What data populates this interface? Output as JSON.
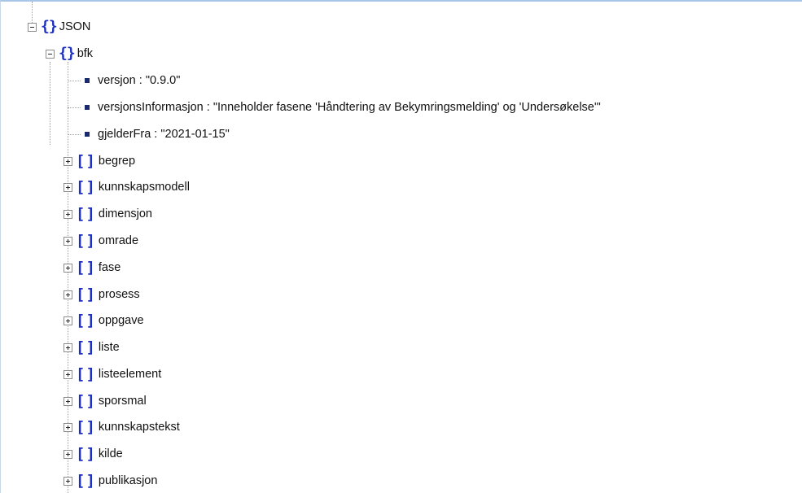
{
  "tree": {
    "root": {
      "label": "JSON",
      "icon": "object-icon",
      "expanded": true
    },
    "bfk": {
      "label": "bfk",
      "icon": "object-icon",
      "expanded": true
    },
    "values": [
      {
        "label": "versjon : \"0.9.0\"",
        "icon": "value-icon"
      },
      {
        "label": "versjonsInformasjon : \"Inneholder fasene 'Håndtering av Bekymringsmelding' og 'Undersøkelse'\"",
        "icon": "value-icon"
      },
      {
        "label": "gjelderFra : \"2021-01-15\"",
        "icon": "value-icon"
      }
    ],
    "arrays": [
      {
        "label": "begrep",
        "icon": "array-icon",
        "expanded": false
      },
      {
        "label": "kunnskapsmodell",
        "icon": "array-icon",
        "expanded": false
      },
      {
        "label": "dimensjon",
        "icon": "array-icon",
        "expanded": false
      },
      {
        "label": "omrade",
        "icon": "array-icon",
        "expanded": false
      },
      {
        "label": "fase",
        "icon": "array-icon",
        "expanded": false
      },
      {
        "label": "prosess",
        "icon": "array-icon",
        "expanded": false
      },
      {
        "label": "oppgave",
        "icon": "array-icon",
        "expanded": false
      },
      {
        "label": "liste",
        "icon": "array-icon",
        "expanded": false
      },
      {
        "label": "listeelement",
        "icon": "array-icon",
        "expanded": false
      },
      {
        "label": "sporsmal",
        "icon": "array-icon",
        "expanded": false
      },
      {
        "label": "kunnskapstekst",
        "icon": "array-icon",
        "expanded": false
      },
      {
        "label": "kilde",
        "icon": "array-icon",
        "expanded": false
      },
      {
        "label": "publikasjon",
        "icon": "array-icon",
        "expanded": false
      }
    ],
    "colors": {
      "icon_blue": "#1c2fbf",
      "value_square": "#1b2a6b",
      "connector": "#a0a0a0",
      "border": "#a9c6e8"
    }
  }
}
